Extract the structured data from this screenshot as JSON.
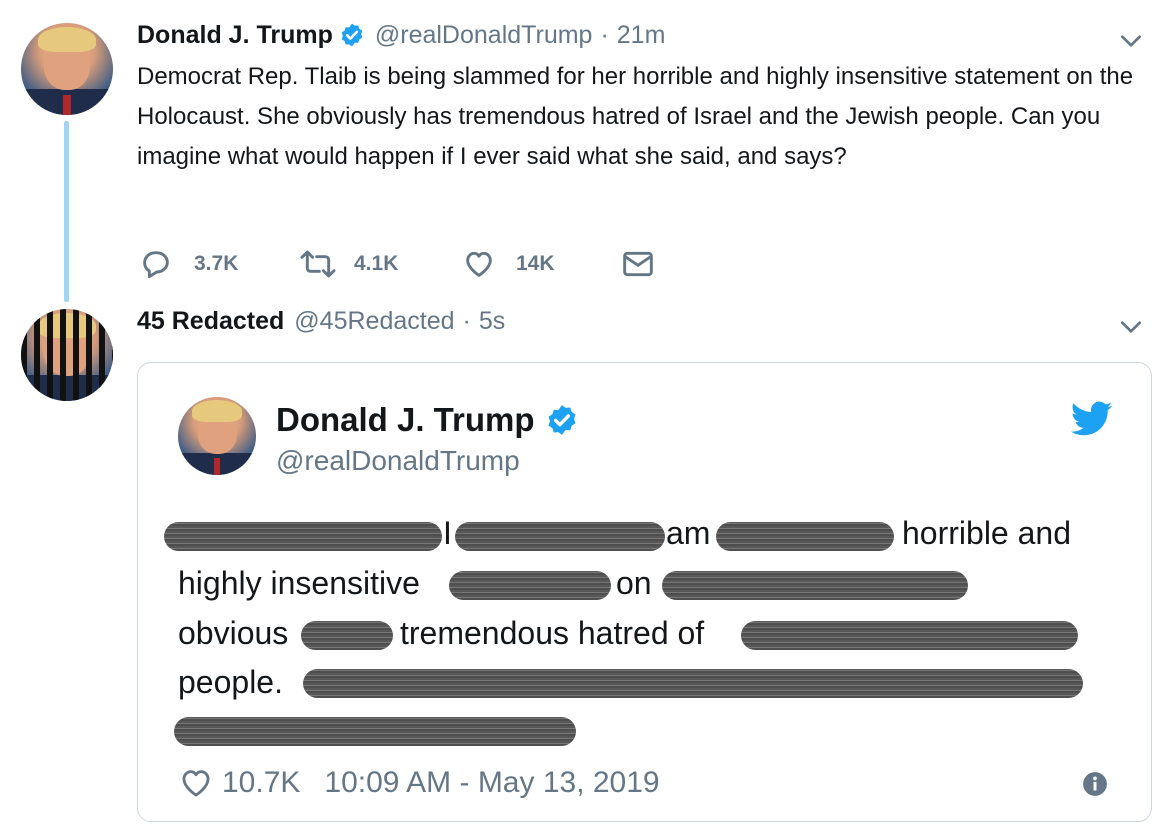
{
  "tweet": {
    "name": "Donald J. Trump",
    "handle": "@realDonaldTrump",
    "separator": "·",
    "time": "21m",
    "text": "Democrat Rep. Tlaib is being slammed for her horrible and highly insensitive statement on the Holocaust. She obviously has tremendous hatred of Israel and the Jewish people. Can you imagine what would happen if I ever said what she said, and says?",
    "reply_count": "3.7K",
    "retweet_count": "4.1K",
    "like_count": "14K"
  },
  "reply": {
    "name": "45 Redacted",
    "handle": "@45Redacted",
    "separator": "·",
    "time": "5s"
  },
  "card": {
    "name": "Donald J. Trump",
    "handle": "@realDonaldTrump",
    "fragments": {
      "f1": "I",
      "f2": "am",
      "f3": "horrible and",
      "f4": "highly insensitive",
      "f5": "on",
      "f6": "obvious",
      "f7": "tremendous hatred of",
      "f8": "people."
    },
    "like_count": "10.7K",
    "timestamp": "10:09 AM - May 13, 2019"
  },
  "colors": {
    "verified": "#1da1f2",
    "thread_line": "#9fd6f5",
    "secondary_text": "#657786",
    "twitter_blue": "#1da1f2"
  },
  "icons": [
    "verified-badge-icon",
    "chevron-down-icon",
    "reply-icon",
    "retweet-icon",
    "like-icon",
    "dm-icon",
    "twitter-bird-icon",
    "info-icon"
  ]
}
